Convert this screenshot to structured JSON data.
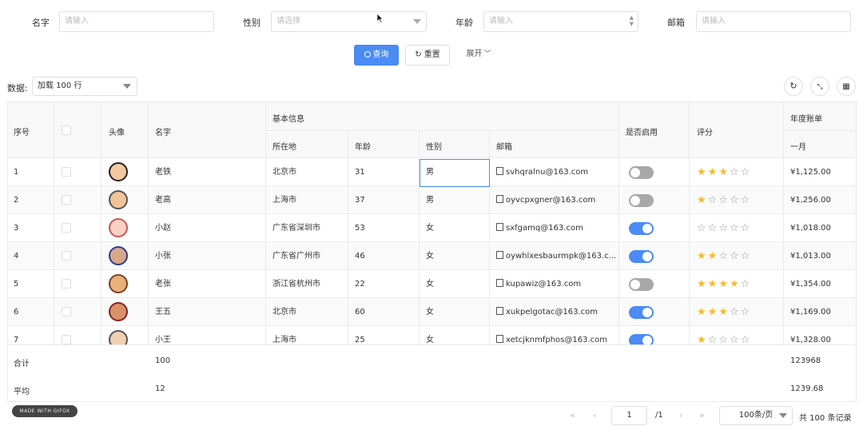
{
  "search": {
    "name_label": "名字",
    "name_placeholder": "请输入",
    "gender_label": "性别",
    "gender_placeholder": "请选择",
    "age_label": "年龄",
    "age_placeholder": "请输入",
    "email_label": "邮箱",
    "email_placeholder": "请输入",
    "query_button": "查询",
    "reset_button": "重置",
    "expand_button": "展开"
  },
  "toolbar": {
    "data_label": "数据:",
    "load_select": "加载 100 行"
  },
  "table": {
    "headers": {
      "index": "序号",
      "avatar": "头像",
      "name": "名字",
      "basic_info": "基本信息",
      "location": "所在地",
      "age": "年龄",
      "gender": "性别",
      "email": "邮箱",
      "enabled": "是否启用",
      "rating": "评分",
      "annual_bill": "年度账单",
      "month": "一月"
    },
    "rows": [
      {
        "index": "1",
        "name": "老铁",
        "location": "北京市",
        "age": "31",
        "gender": "男",
        "email": "svhqralnu@163.com",
        "enabled": false,
        "rating": 3,
        "bill": "¥1,125.00"
      },
      {
        "index": "2",
        "name": "老高",
        "location": "上海市",
        "age": "37",
        "gender": "男",
        "email": "oyvcpxgner@163.com",
        "enabled": false,
        "rating": 1,
        "bill": "¥1,256.00"
      },
      {
        "index": "3",
        "name": "小赵",
        "location": "广东省深圳市",
        "age": "53",
        "gender": "女",
        "email": "sxfgamq@163.com",
        "enabled": true,
        "rating": 0,
        "bill": "¥1,018.00"
      },
      {
        "index": "4",
        "name": "小张",
        "location": "广东省广州市",
        "age": "46",
        "gender": "女",
        "email": "oywhlxesbaurmpk@163.c...",
        "enabled": true,
        "rating": 2,
        "bill": "¥1,013.00"
      },
      {
        "index": "5",
        "name": "老张",
        "location": "浙江省杭州市",
        "age": "22",
        "gender": "女",
        "email": "kupawiz@163.com",
        "enabled": false,
        "rating": 4,
        "bill": "¥1,354.00"
      },
      {
        "index": "6",
        "name": "王五",
        "location": "北京市",
        "age": "60",
        "gender": "女",
        "email": "xukpelgotac@163.com",
        "enabled": true,
        "rating": 3,
        "bill": "¥1,169.00"
      },
      {
        "index": "7",
        "name": "小王",
        "location": "上海市",
        "age": "25",
        "gender": "女",
        "email": "xetcjknmfphos@163.com",
        "enabled": true,
        "rating": 1,
        "bill": "¥1,328.00"
      }
    ],
    "footer": {
      "sum_label": "合计",
      "sum_name": "100",
      "sum_bill": "123968",
      "avg_label": "平均",
      "avg_name": "12",
      "avg_bill": "1239.68"
    }
  },
  "pagination": {
    "current_page": "1",
    "total_pages": "/1",
    "page_size": "100条/页",
    "total_records": "共 100 条记录"
  },
  "badge": "MADE WITH GIFOX",
  "colors": {
    "primary": "#4a8bf5",
    "star": "#f7ba2a",
    "switch_off": "#a8a8a8"
  }
}
